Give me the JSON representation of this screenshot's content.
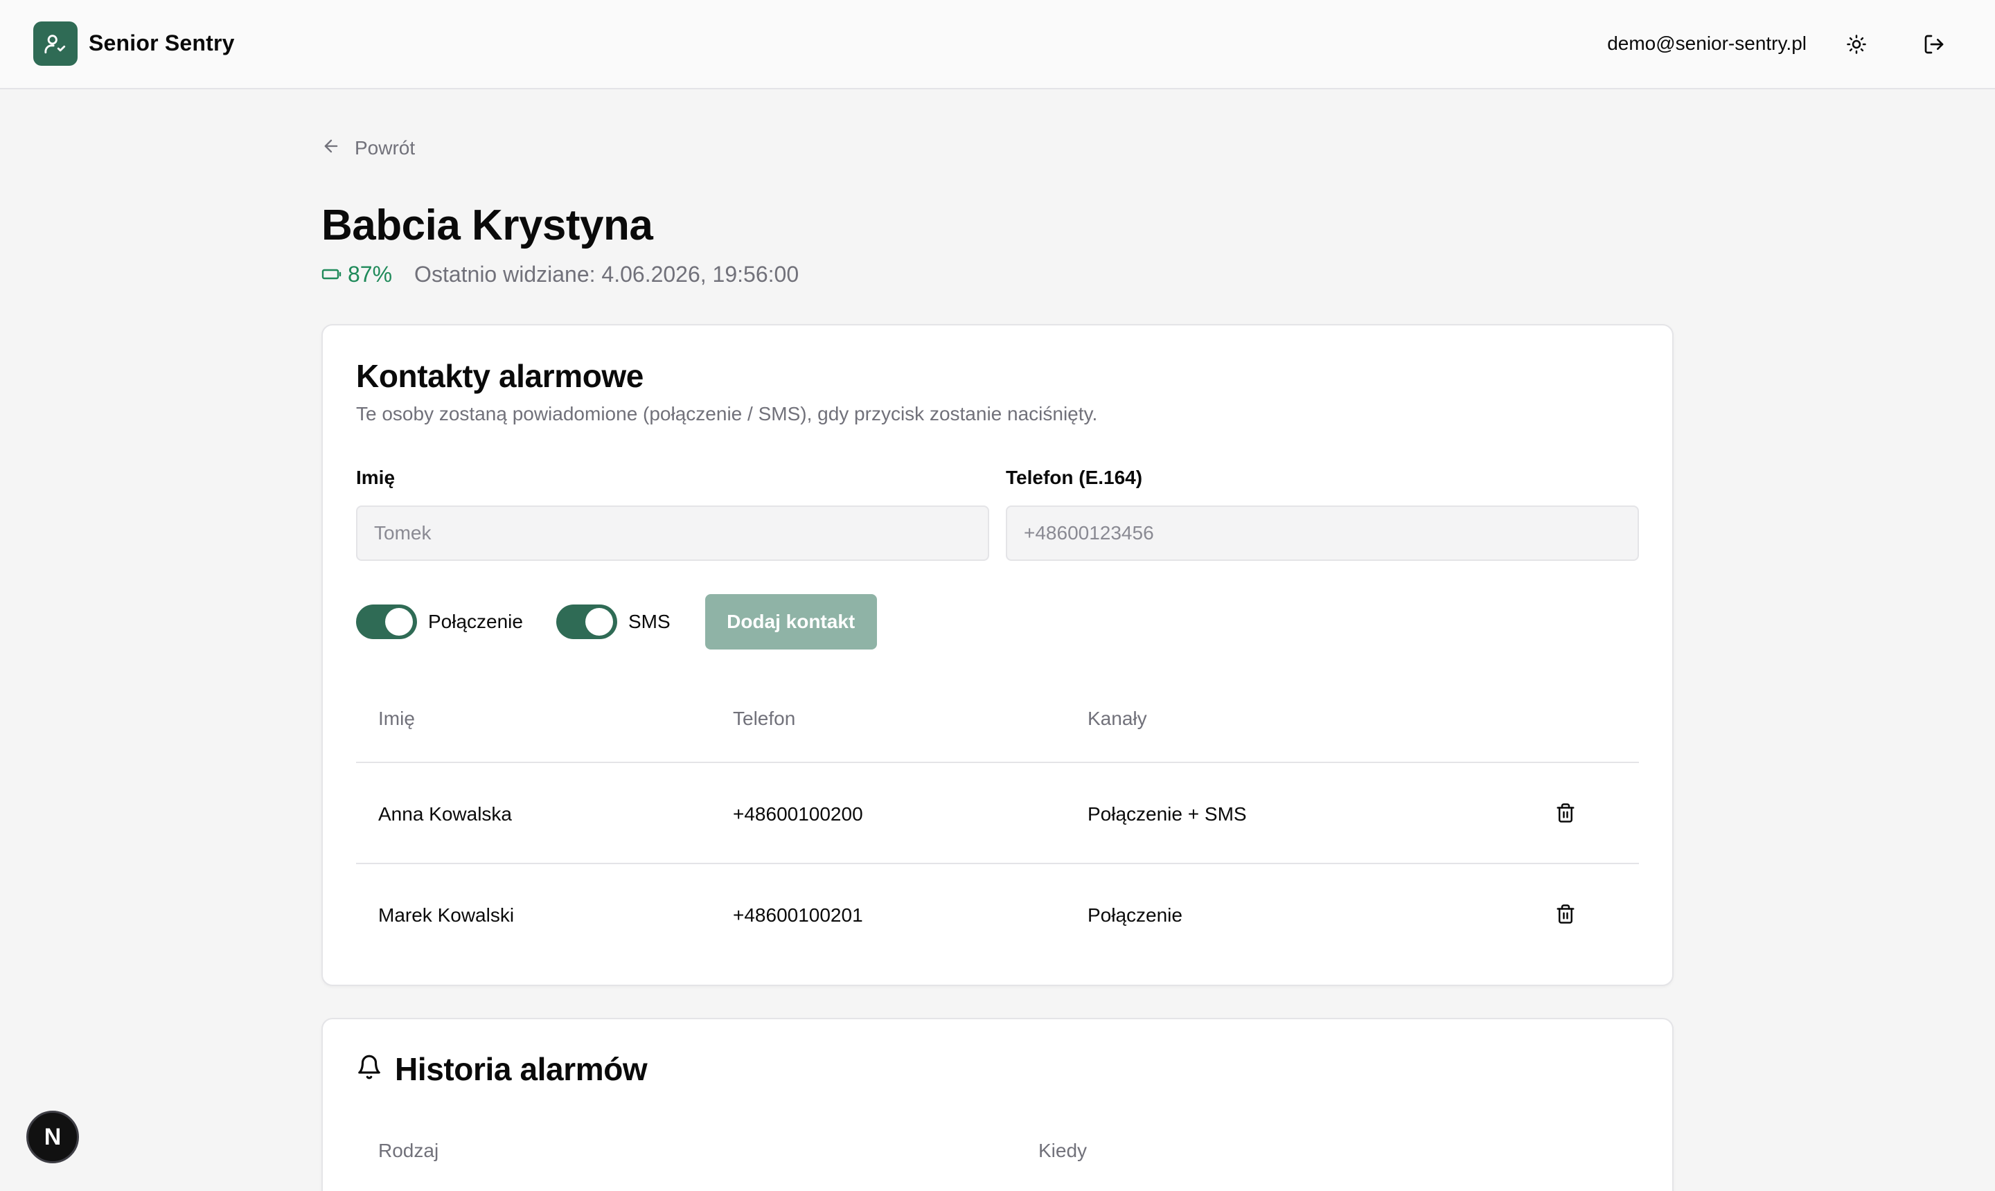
{
  "header": {
    "brand": "Senior Sentry",
    "user_email": "demo@senior-sentry.pl"
  },
  "back_label": "Powrót",
  "senior": {
    "name": "Babcia Krystyna",
    "battery": "87%",
    "last_seen": "Ostatnio widziane: 4.06.2026, 19:56:00"
  },
  "contacts": {
    "title": "Kontakty alarmowe",
    "description": "Te osoby zostaną powiadomione (połączenie / SMS), gdy przycisk zostanie naciśnięty.",
    "name_label": "Imię",
    "name_placeholder": "Tomek",
    "phone_label": "Telefon (E.164)",
    "phone_placeholder": "+48600123456",
    "toggle_call_label": "Połączenie",
    "toggle_call_on": true,
    "toggle_sms_label": "SMS",
    "toggle_sms_on": true,
    "add_button": "Dodaj kontakt",
    "columns": [
      "Imię",
      "Telefon",
      "Kanały"
    ],
    "rows": [
      {
        "name": "Anna Kowalska",
        "phone": "+48600100200",
        "channels": "Połączenie + SMS"
      },
      {
        "name": "Marek Kowalski",
        "phone": "+48600100201",
        "channels": "Połączenie"
      }
    ]
  },
  "history": {
    "title": "Historia alarmów",
    "columns": [
      "Rodzaj",
      "Kiedy"
    ]
  },
  "dev_badge": "N",
  "colors": {
    "accent": "#2f6b55",
    "accent_disabled": "#8fb3a6",
    "battery_green": "#1f8a5a",
    "muted_text": "#71717a"
  },
  "icons": {
    "logo": "user-check-icon",
    "theme": "sun-icon",
    "logout": "logout-icon",
    "back": "arrow-left-icon",
    "battery": "battery-icon",
    "delete": "trash-icon",
    "history": "bell-icon"
  }
}
